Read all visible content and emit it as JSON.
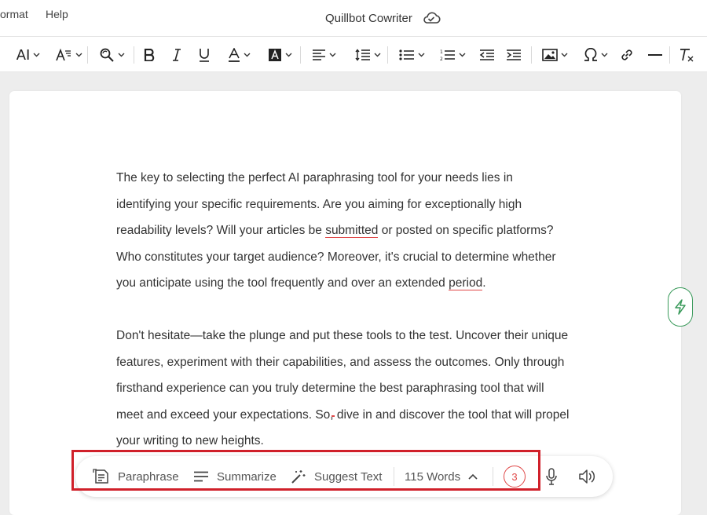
{
  "menu": {
    "format_label": "ormat",
    "help_label": "Help"
  },
  "document": {
    "title": "Quillbot Cowriter",
    "cloud_icon": "cloud-sync-icon"
  },
  "toolbar": {
    "font_size_label": "AI",
    "icons": [
      "font-size-icon",
      "text-style-icon",
      "find-replace-icon",
      "bold-icon",
      "italic-icon",
      "underline-icon",
      "font-color-icon",
      "highlight-color-icon",
      "align-icon",
      "line-height-icon",
      "bullet-list-icon",
      "numbered-list-icon",
      "outdent-icon",
      "indent-icon",
      "image-icon",
      "special-char-icon",
      "link-icon",
      "horizontal-line-icon",
      "clear-format-icon"
    ]
  },
  "content": {
    "paragraph1": {
      "l1": "The key to selecting the perfect AI paraphrasing tool for your needs lies in",
      "l2": "identifying your specific requirements. Are you aiming for exceptionally high",
      "l3_a": "readability levels? Will your articles be ",
      "l3_err": "submitted",
      "l3_b": " or posted on specific platforms?",
      "l4": "Who constitutes your target audience? Moreover, it's crucial to determine whether",
      "l5_a": "you anticipate using the tool frequently and over an extended ",
      "l5_err": "period",
      "l5_b": "."
    },
    "paragraph2": {
      "l1": "Don't hesitate—take the plunge and put these tools to the test. Uncover their unique",
      "l2": "features, experiment with their capabilities, and assess the outcomes. Only through",
      "l3": "firsthand experience can you truly determine the best paraphrasing tool that will",
      "l4_a": "meet and exceed your expectations. So",
      "l4_err": ",",
      "l4_b": " dive in and discover the tool that will propel",
      "l5": "your writing to new heights."
    }
  },
  "bottom_bar": {
    "paraphrase_label": "Paraphrase",
    "summarize_label": "Summarize",
    "suggest_label": "Suggest Text",
    "word_count_label": "115 Words",
    "issues_count": "3"
  },
  "colors": {
    "accent_green": "#3a9a5b",
    "error_red": "#e04848",
    "highlight_box": "#d0202a"
  }
}
